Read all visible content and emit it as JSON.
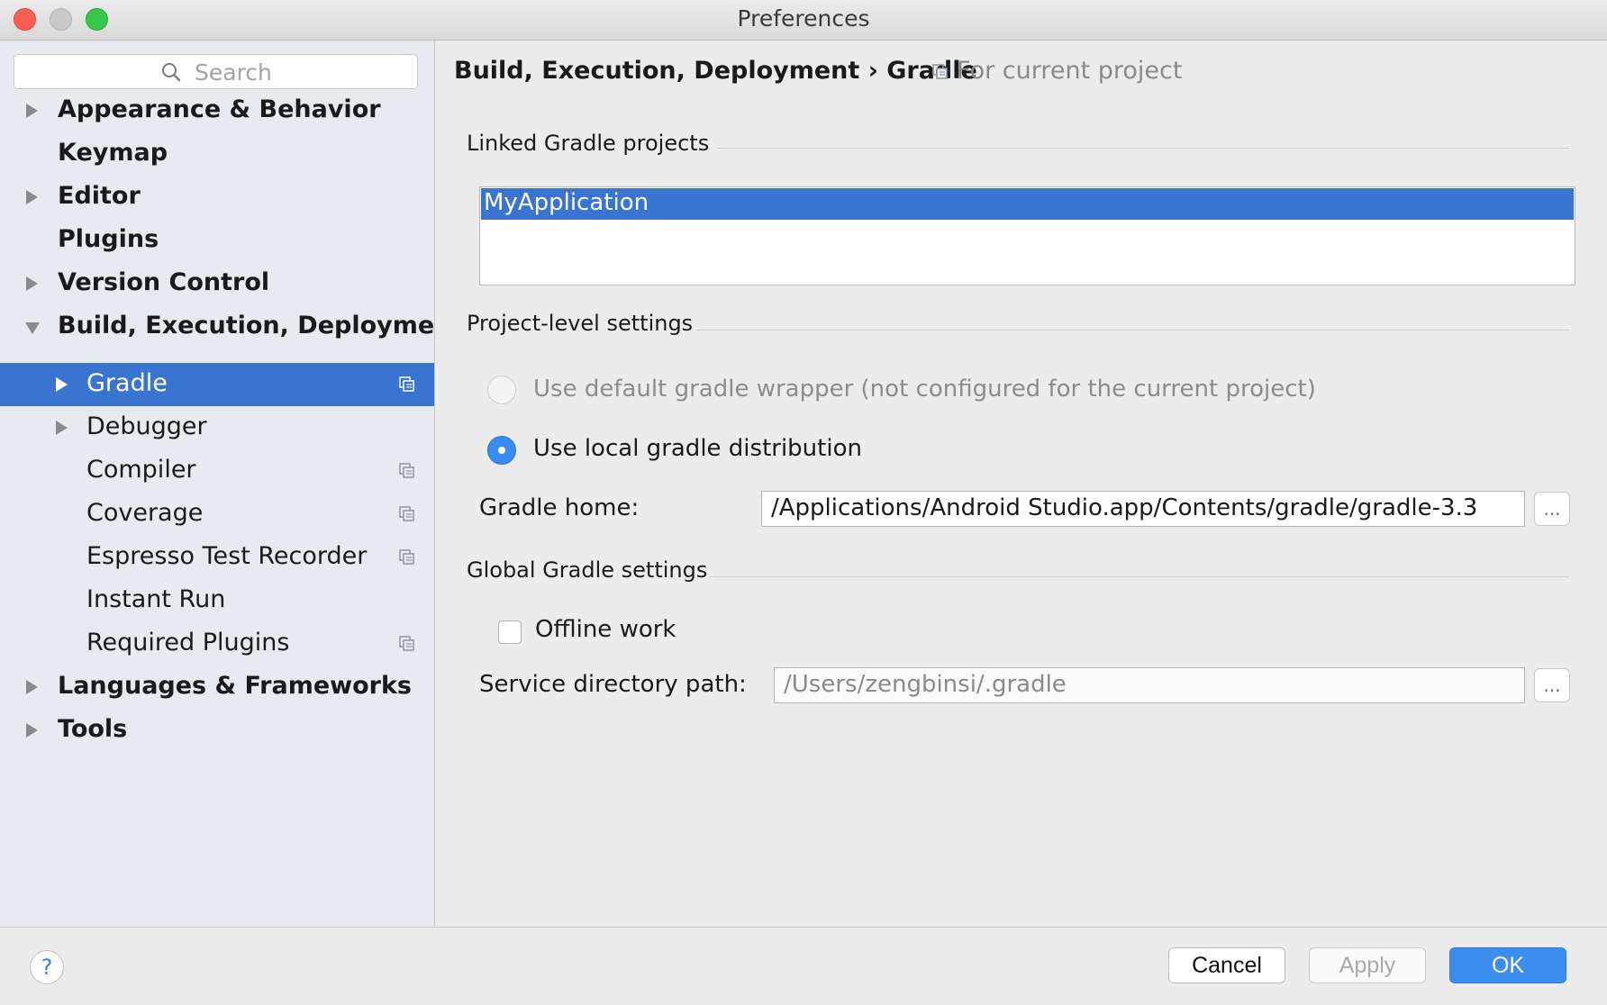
{
  "window": {
    "title": "Preferences"
  },
  "sidebar": {
    "search_placeholder": "Search",
    "items": [
      {
        "label": "Appearance & Behavior",
        "arrow": "right"
      },
      {
        "label": "Keymap"
      },
      {
        "label": "Editor",
        "arrow": "right"
      },
      {
        "label": "Plugins"
      },
      {
        "label": "Version Control",
        "arrow": "right"
      },
      {
        "label": "Build, Execution, Deployment",
        "arrow": "down"
      },
      {
        "label": "Gradle",
        "arrow": "right",
        "selected": true,
        "project_icon": "project-scope-icon"
      },
      {
        "label": "Debugger",
        "arrow": "right"
      },
      {
        "label": "Compiler",
        "project_icon": "project-scope-icon"
      },
      {
        "label": "Coverage",
        "project_icon": "project-scope-icon"
      },
      {
        "label": "Espresso Test Recorder",
        "project_icon": "project-scope-icon"
      },
      {
        "label": "Instant Run"
      },
      {
        "label": "Required Plugins",
        "project_icon": "project-scope-icon"
      },
      {
        "label": "Languages & Frameworks",
        "arrow": "right"
      },
      {
        "label": "Tools",
        "arrow": "right"
      }
    ]
  },
  "header": {
    "breadcrumb": "Build, Execution, Deployment › Gradle",
    "scope_label": "For current project"
  },
  "linked_projects": {
    "title": "Linked Gradle projects",
    "items": [
      "MyApplication"
    ]
  },
  "project_settings": {
    "title": "Project-level settings",
    "option_default": "Use default gradle wrapper (not configured for the current project)",
    "option_local": "Use local gradle distribution",
    "selected_option": "local",
    "gradle_home_label": "Gradle home:",
    "gradle_home_value": "/Applications/Android Studio.app/Contents/gradle/gradle-3.3",
    "browse_label": "..."
  },
  "global_settings": {
    "title": "Global Gradle settings",
    "offline_label": "Offline work",
    "offline_checked": false,
    "service_dir_label": "Service directory path:",
    "service_dir_value": "/Users/zengbinsi/.gradle",
    "browse_label": "..."
  },
  "footer": {
    "help_label": "?",
    "cancel_label": "Cancel",
    "apply_label": "Apply",
    "ok_label": "OK"
  },
  "colors": {
    "selection": "#3874d0",
    "accent": "#3b8ef0",
    "close": "#fc5d55",
    "maximize": "#35c84a"
  }
}
